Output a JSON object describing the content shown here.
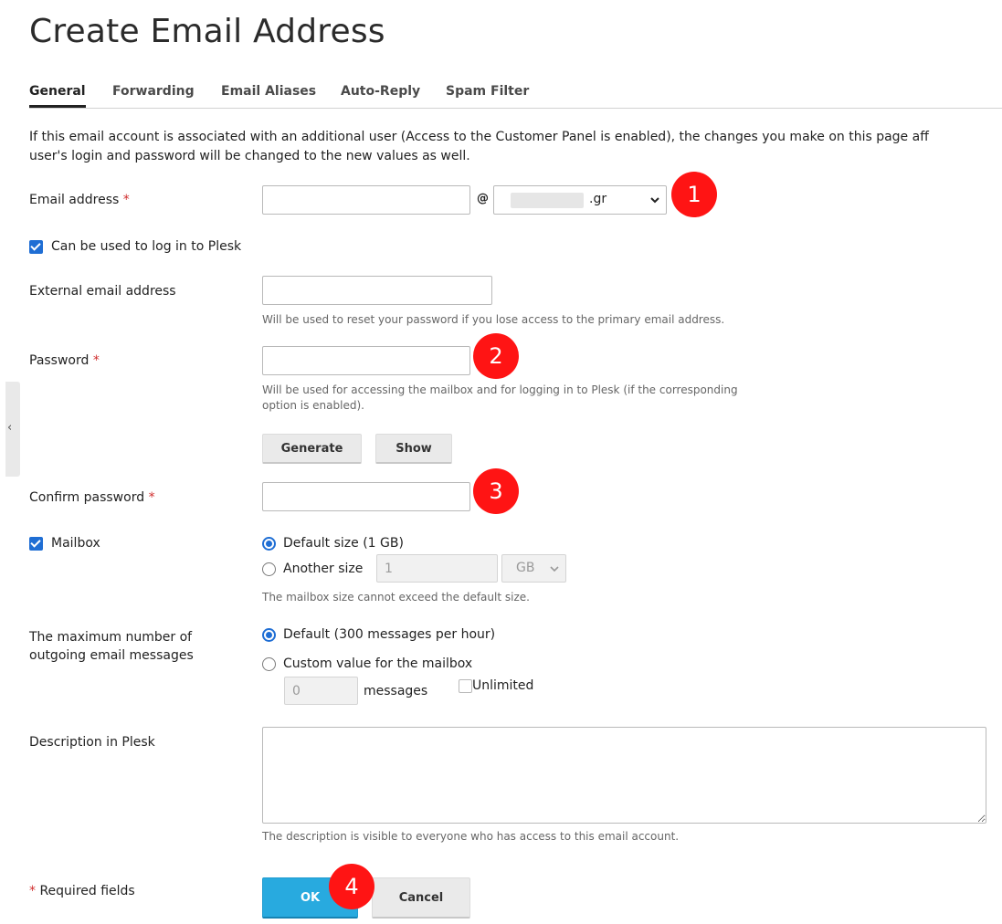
{
  "page": {
    "title": "Create Email Address"
  },
  "tabs": [
    {
      "label": "General",
      "active": true
    },
    {
      "label": "Forwarding"
    },
    {
      "label": "Email Aliases"
    },
    {
      "label": "Auto-Reply"
    },
    {
      "label": "Spam Filter"
    }
  ],
  "info": {
    "line1": "If this email account is associated with an additional user (Access to the Customer Panel is enabled), the changes you make on this page aff",
    "line2": "user's login and password will be changed to the new values as well."
  },
  "email": {
    "label": "Email address",
    "required": "*",
    "value": "",
    "at": "@",
    "domain_suffix": ".gr"
  },
  "login": {
    "label": "Can be used to log in to Plesk",
    "checked": true
  },
  "external": {
    "label": "External email address",
    "value": "",
    "hint": "Will be used to reset your password if you lose access to the primary email address."
  },
  "password": {
    "label": "Password",
    "required": "*",
    "value": "",
    "hint_line1": "Will be used for accessing the mailbox and for logging in to Plesk (if the corresponding",
    "hint_line2": "option is enabled).",
    "generate_label": "Generate",
    "show_label": "Show"
  },
  "confirm": {
    "label": "Confirm password",
    "required": "*",
    "value": ""
  },
  "mailbox": {
    "label": "Mailbox",
    "checked": true,
    "default_label": "Default size (1 GB)",
    "another_label": "Another size",
    "size_value": "1",
    "unit": "GB",
    "hint": "The mailbox size cannot exceed the default size."
  },
  "outgoing": {
    "label_line1": "The maximum number of",
    "label_line2": "outgoing email messages",
    "default_label": "Default (300 messages per hour)",
    "custom_label": "Custom value for the mailbox",
    "count_value": "0",
    "messages_label": "messages",
    "unlimited_label": "Unlimited"
  },
  "description": {
    "label": "Description in Plesk",
    "value": "",
    "hint": "The description is visible to everyone who has access to this email account."
  },
  "footer": {
    "required_star": "*",
    "required_label": "Required fields",
    "ok_label": "OK",
    "cancel_label": "Cancel"
  },
  "annotations": [
    "1",
    "2",
    "3",
    "4"
  ],
  "colors": {
    "accent": "#28aadf",
    "badge": "#ff1414",
    "checkbox": "#1f6ed4",
    "required": "#d02e2e"
  }
}
